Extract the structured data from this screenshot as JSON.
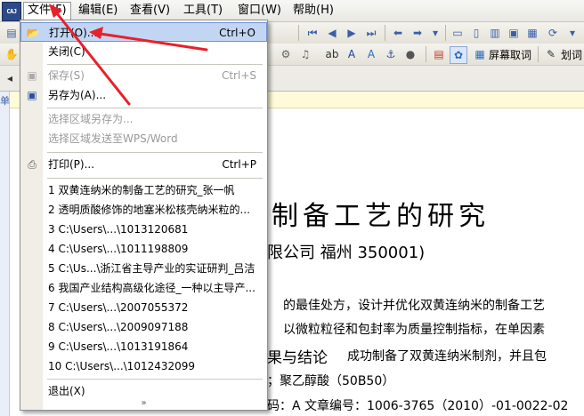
{
  "app": {
    "icon_text": "CAJ"
  },
  "menubar": {
    "items": [
      {
        "key": "file",
        "label": "文件(F)"
      },
      {
        "key": "edit",
        "label": "编辑(E)"
      },
      {
        "key": "view",
        "label": "查看(V)"
      },
      {
        "key": "tools",
        "label": "工具(T)"
      },
      {
        "key": "window",
        "label": "窗口(W)"
      },
      {
        "key": "help",
        "label": "帮助(H)"
      }
    ]
  },
  "toolbar": {
    "screen_copy_label": "屏幕取词",
    "draw_word_label": "划词"
  },
  "left_strip": {
    "label": "单"
  },
  "file_menu": {
    "items": [
      {
        "key": "open",
        "label": "打开(O)...",
        "shortcut": "Ctrl+O",
        "disabled": false,
        "icon": "open-folder-icon"
      },
      {
        "key": "close",
        "label": "关闭(C)",
        "shortcut": "",
        "disabled": false,
        "icon": ""
      },
      {
        "key": "save",
        "label": "保存(S)",
        "shortcut": "Ctrl+S",
        "disabled": true,
        "icon": "save-icon"
      },
      {
        "key": "save_as",
        "label": "另存为(A)...",
        "shortcut": "",
        "disabled": false,
        "icon": "save-as-icon"
      },
      {
        "key": "save_region",
        "label": "选择区域另存为...",
        "shortcut": "",
        "disabled": true,
        "icon": ""
      },
      {
        "key": "send_region",
        "label": "选择区域发送至WPS/Word",
        "shortcut": "",
        "disabled": true,
        "icon": ""
      },
      {
        "key": "print",
        "label": "打印(P)...",
        "shortcut": "Ctrl+P",
        "disabled": false,
        "icon": "printer-icon"
      }
    ],
    "recent_files": [
      "1 双黄连纳米的制备工艺的研究_张一帆",
      "2 透明质酸修饰的地塞米松核壳纳米粒的...",
      "3 C:\\Users\\...\\1013120681",
      "4 C:\\Users\\...\\1011198809",
      "5 C:\\Us...\\浙江省主导产业的实证研判_吕洁",
      "6 我国产业结构高级化途径_一种以主导产...",
      "7 C:\\Users\\...\\2007055372",
      "8 C:\\Users\\...\\2009097188",
      "9 C:\\Users\\...\\1013191864",
      "10 C:\\Users\\...\\1012432099"
    ],
    "exit_label": "退出(X)",
    "expand_glyph": "»"
  },
  "document": {
    "title": "制备工艺的研究",
    "affiliation": "限公司  福州  350001)",
    "body_line1": "的最佳处方，设计并优化双黄连纳米的制备工艺",
    "body_line2": "以微粒粒径和包封率为质量控制指标，在单因素",
    "results_heading": "果与结论",
    "results_text": "成功制备了双黄连纳米制剂，并且包",
    "keywords_line": "；聚乙醇酸（50B50）",
    "footer_line": "码：A    文章编号：1006-3765（2010）-01-0022-02"
  },
  "colors": {
    "annotation_red": "#e8202a",
    "highlight": "#c2d6f4"
  }
}
